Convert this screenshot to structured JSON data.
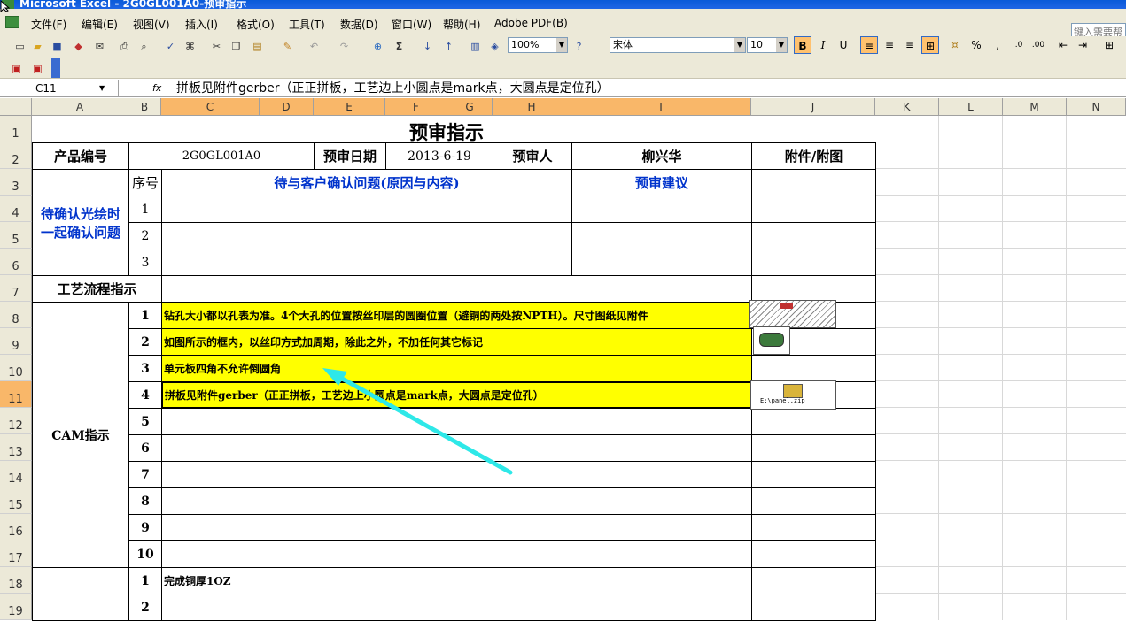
{
  "window": {
    "title": "Microsoft Excel - 2G0GL001A0-预审指示"
  },
  "menu": [
    "文件(F)",
    "编辑(E)",
    "视图(V)",
    "插入(I)",
    "格式(O)",
    "工具(T)",
    "数据(D)",
    "窗口(W)",
    "帮助(H)",
    "Adobe PDF(B)"
  ],
  "help_search_placeholder": "键入需要帮",
  "toolbar": {
    "zoom": "100%",
    "font": "宋体",
    "font_size": "10",
    "bold": "B",
    "italic": "I",
    "underline": "U",
    "percent": "%",
    "comma": ","
  },
  "formula_bar": {
    "name_box": "C11",
    "fx": "fx",
    "content": "拼板见附件gerber（正正拼板，工艺边上小圆点是mark点，大圆点是定位孔）"
  },
  "columns": [
    "A",
    "B",
    "C",
    "D",
    "E",
    "F",
    "G",
    "H",
    "I",
    "J",
    "K",
    "L",
    "M",
    "N"
  ],
  "rows": [
    "1",
    "2",
    "3",
    "4",
    "5",
    "6",
    "7",
    "8",
    "9",
    "10",
    "11",
    "12",
    "13",
    "14",
    "15",
    "16",
    "17",
    "18",
    "19"
  ],
  "sheet": {
    "title": "预审指示",
    "product_label": "产品编号",
    "product_no": "2G0GL001A0",
    "review_date_label": "预审日期",
    "review_date": "2013-6-19",
    "reviewer_label": "预审人",
    "reviewer": "柳兴华",
    "attachment_label": "附件/附图",
    "seq_label": "序号",
    "issue_header": "待与客户确认问题(原因与内容)",
    "suggest_header": "预审建议",
    "pending_label": "待确认光绘时一起确认问题",
    "pending_seqs": [
      "1",
      "2",
      "3"
    ],
    "process_label": "工艺流程指示",
    "cam_label": "CAM指示",
    "cam_items": [
      {
        "seq": "1",
        "text": "钻孔大小都以孔表为准。4个大孔的位置按丝印层的圆圈位置（避铜的两处按NPTH）。尺寸图纸见附件"
      },
      {
        "seq": "2",
        "text": "如图所示的框内，以丝印方式加周期，除此之外，不加任何其它标记"
      },
      {
        "seq": "3",
        "text": "单元板四角不允许倒圆角"
      },
      {
        "seq": "4",
        "text": "拼板见附件gerber（正正拼板，工艺边上小圆点是mark点，大圆点是定位孔）"
      },
      {
        "seq": "5",
        "text": ""
      },
      {
        "seq": "6",
        "text": ""
      },
      {
        "seq": "7",
        "text": ""
      },
      {
        "seq": "8",
        "text": ""
      },
      {
        "seq": "9",
        "text": ""
      },
      {
        "seq": "10",
        "text": ""
      }
    ],
    "other_items": [
      {
        "seq": "1",
        "text": "完成铜厚1OZ"
      },
      {
        "seq": "2",
        "text": ""
      }
    ],
    "attachment_file": "E:\\panel.zip"
  },
  "colors": {
    "highlight": "#ffff00",
    "blue_text": "#0033cc",
    "arrow": "#2ee8e8",
    "selected_header": "#f9b769"
  }
}
